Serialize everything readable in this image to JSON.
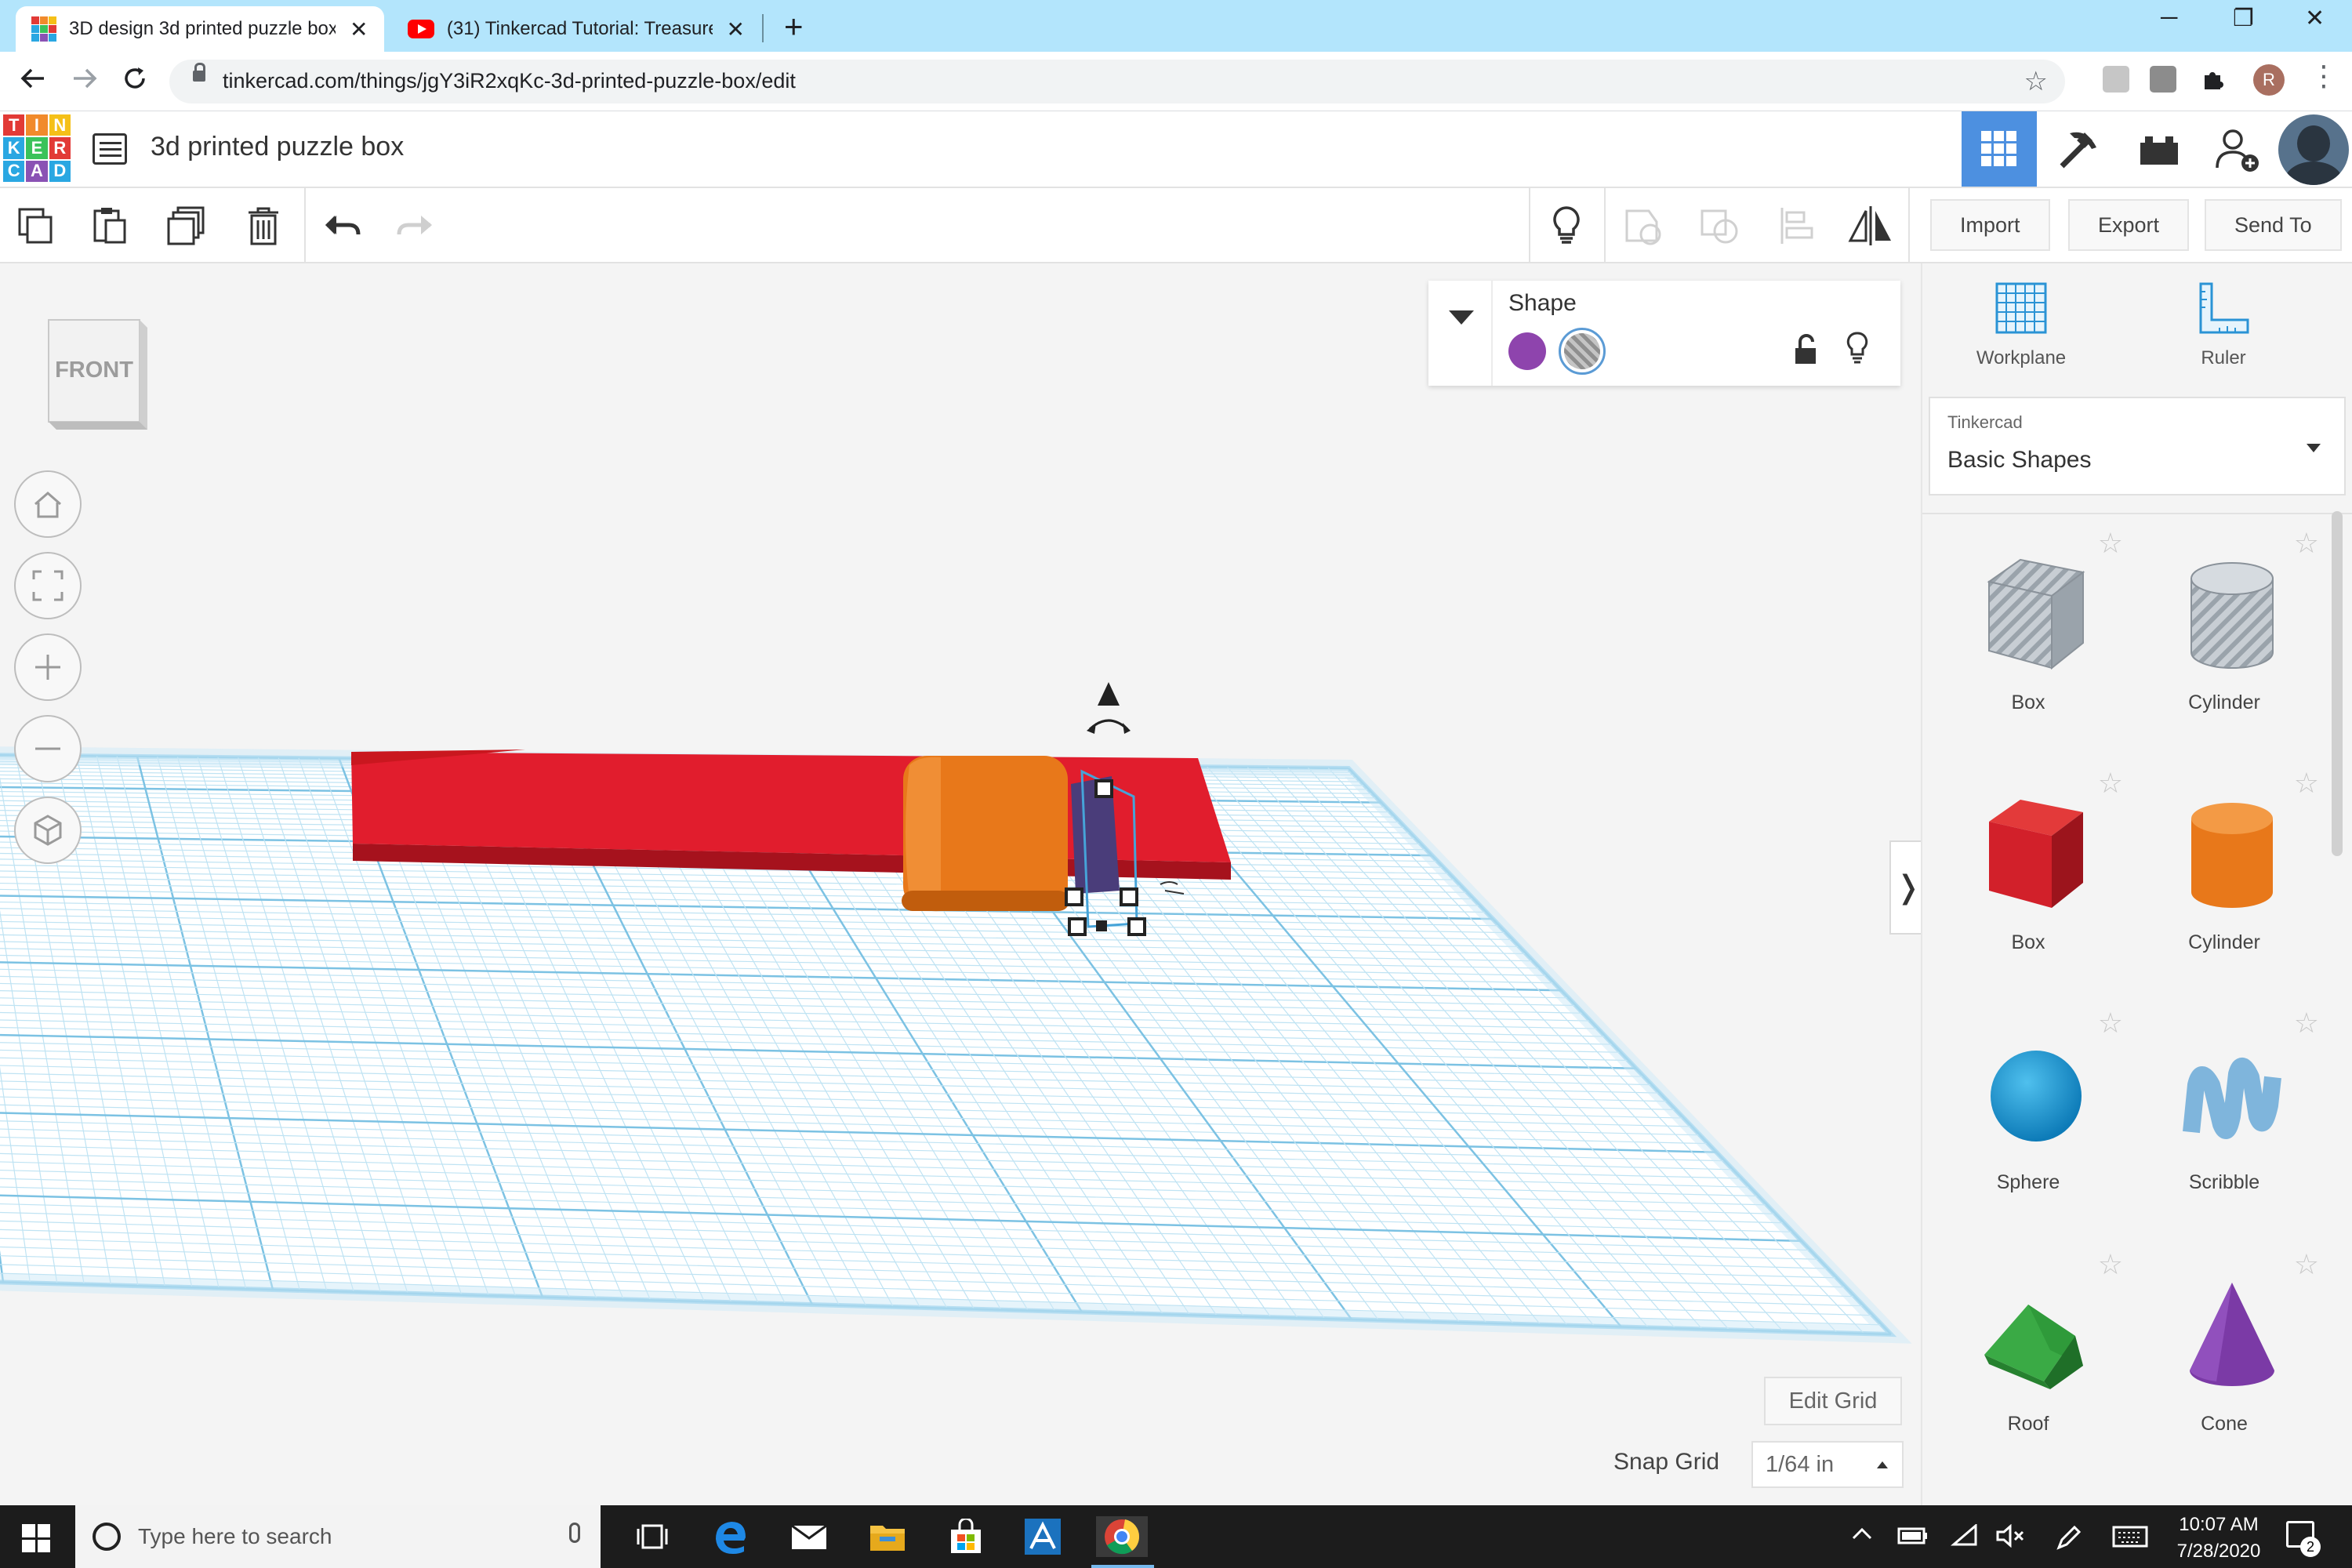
{
  "browser": {
    "tabs": [
      {
        "title": "3D design 3d printed puzzle box",
        "active": true
      },
      {
        "title": "(31) Tinkercad Tutorial: Treasure",
        "active": false
      }
    ],
    "new_tab_symbol": "+",
    "tab_close_symbol": "✕",
    "window_controls": {
      "minimize": "─",
      "maximize": "❐",
      "close": "✕"
    },
    "url": "tinkercad.com/things/jgY3iR2xqKc-3d-printed-puzzle-box/edit",
    "profile_initial": "R",
    "icons": [
      "back-icon",
      "forward-icon",
      "reload-icon",
      "lock-icon",
      "bookmark-star-icon",
      "extensions-icon",
      "menu-icon"
    ]
  },
  "app": {
    "logo_letters": [
      "T",
      "I",
      "N",
      "K",
      "E",
      "R",
      "C",
      "A",
      "D"
    ],
    "logo_colors": [
      "#e23a36",
      "#f18a2b",
      "#f5c018",
      "#2aa7e2",
      "#3ac25a",
      "#e23a36",
      "#2aa7e2",
      "#8a52b4",
      "#2aa7e2"
    ],
    "design_title": "3d printed puzzle box",
    "header_modes": [
      "3d-design-grid-icon",
      "codeblocks-pickaxe-icon",
      "lego-bricks-icon",
      "add-user-icon"
    ],
    "accent": "#4d90e0"
  },
  "toolbar": {
    "left_tools": [
      "copy-icon",
      "paste-icon",
      "duplicate-icon",
      "delete-icon",
      "undo-icon",
      "redo-icon"
    ],
    "right_tools": [
      "notes-lightbulb-icon",
      "group-icon",
      "ungroup-icon",
      "align-icon",
      "mirror-icon"
    ],
    "import_label": "Import",
    "export_label": "Export",
    "sendto_label": "Send To"
  },
  "canvas": {
    "viewcube_label": "FRONT",
    "view_buttons": [
      "home-view-icon",
      "fit-view-icon",
      "zoom-in-icon",
      "zoom-out-icon",
      "perspective-icon"
    ],
    "shape_panel": {
      "title": "Shape",
      "solid_color": "#8e44ad",
      "icons": [
        "lock-icon",
        "visibility-bulb-icon"
      ]
    },
    "edit_grid_label": "Edit Grid",
    "snap_grid_label": "Snap Grid",
    "snap_grid_value": "1/64 in",
    "collapse_symbol": "❭",
    "objects": [
      {
        "name": "red-box",
        "color": "#e11d2d"
      },
      {
        "name": "orange-cylinder",
        "color": "#e8781a"
      },
      {
        "name": "selected-hole-shape",
        "color": "#5b4a8a"
      }
    ]
  },
  "sidepanel": {
    "workplane_label": "Workplane",
    "ruler_label": "Ruler",
    "library_source": "Tinkercad",
    "library_name": "Basic Shapes",
    "shapes": [
      {
        "name": "Box",
        "kind": "box-hole",
        "color": "#b8bfc6"
      },
      {
        "name": "Cylinder",
        "kind": "cylinder-hole",
        "color": "#b8bfc6"
      },
      {
        "name": "Box",
        "kind": "box",
        "color": "#d2202a"
      },
      {
        "name": "Cylinder",
        "kind": "cylinder",
        "color": "#e8781a"
      },
      {
        "name": "Sphere",
        "kind": "sphere",
        "color": "#1a9bd7"
      },
      {
        "name": "Scribble",
        "kind": "scribble",
        "color": "#7fb5dc"
      },
      {
        "name": "Roof",
        "kind": "roof",
        "color": "#2f9a3a"
      },
      {
        "name": "Cone",
        "kind": "cone",
        "color": "#7b3aa6"
      }
    ]
  },
  "taskbar": {
    "search_placeholder": "Type here to search",
    "time": "10:07 AM",
    "date": "7/28/2020",
    "notification_count": "2",
    "apps": [
      "task-view-icon",
      "edge-icon",
      "mail-icon",
      "file-explorer-icon",
      "store-icon",
      "affinity-icon",
      "chrome-icon"
    ]
  }
}
